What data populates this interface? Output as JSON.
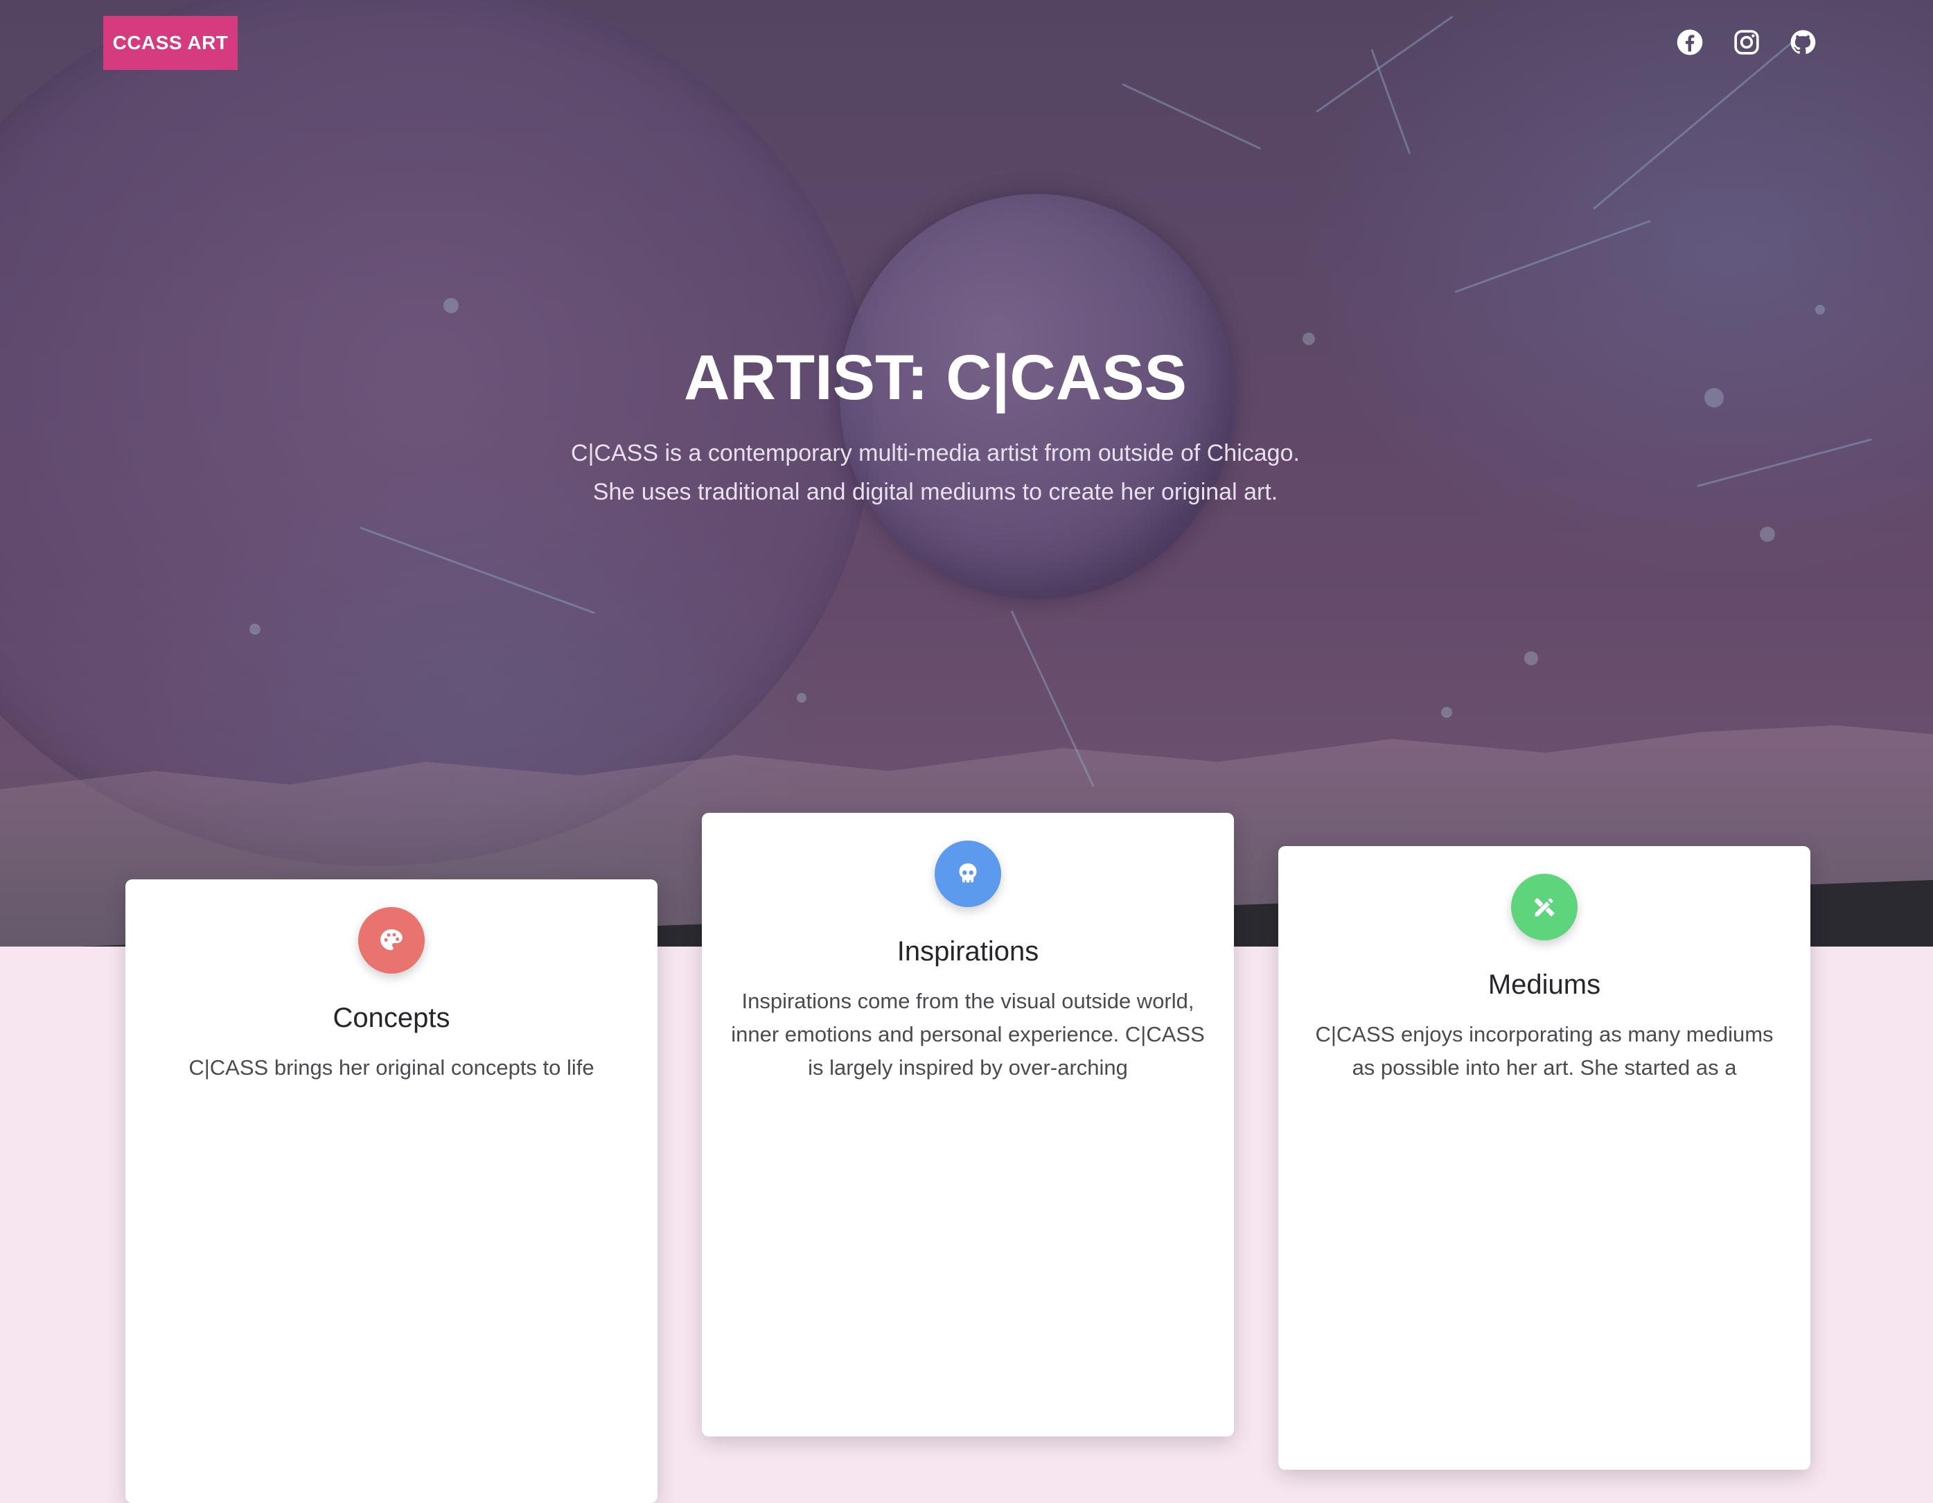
{
  "nav": {
    "brand": "CCASS ART",
    "social": [
      {
        "icon": "facebook-icon"
      },
      {
        "icon": "instagram-icon"
      },
      {
        "icon": "github-icon"
      }
    ]
  },
  "hero": {
    "title": "ARTIST: C|CASS",
    "subtitle_line1": "C|CASS is a contemporary multi-media artist from outside of Chicago.",
    "subtitle_line2": "She uses traditional and digital mediums to create her original art."
  },
  "cards": [
    {
      "icon": "palette-icon",
      "color": "#e8736f",
      "title": "Concepts",
      "text": "C|CASS brings her original concepts to life"
    },
    {
      "icon": "skull-icon",
      "color": "#5b9aed",
      "title": "Inspirations",
      "text": "Inspirations come from the visual outside world, inner emotions and personal experience. C|CASS is largely inspired by over-arching"
    },
    {
      "icon": "pencil-ruler-icon",
      "color": "#5ed47c",
      "title": "Mediums",
      "text": "C|CASS enjoys incorporating as many mediums as possible into her art. She started as a"
    }
  ],
  "colors": {
    "brand": "#d63a7f",
    "page_bg": "#f7e6f0"
  }
}
